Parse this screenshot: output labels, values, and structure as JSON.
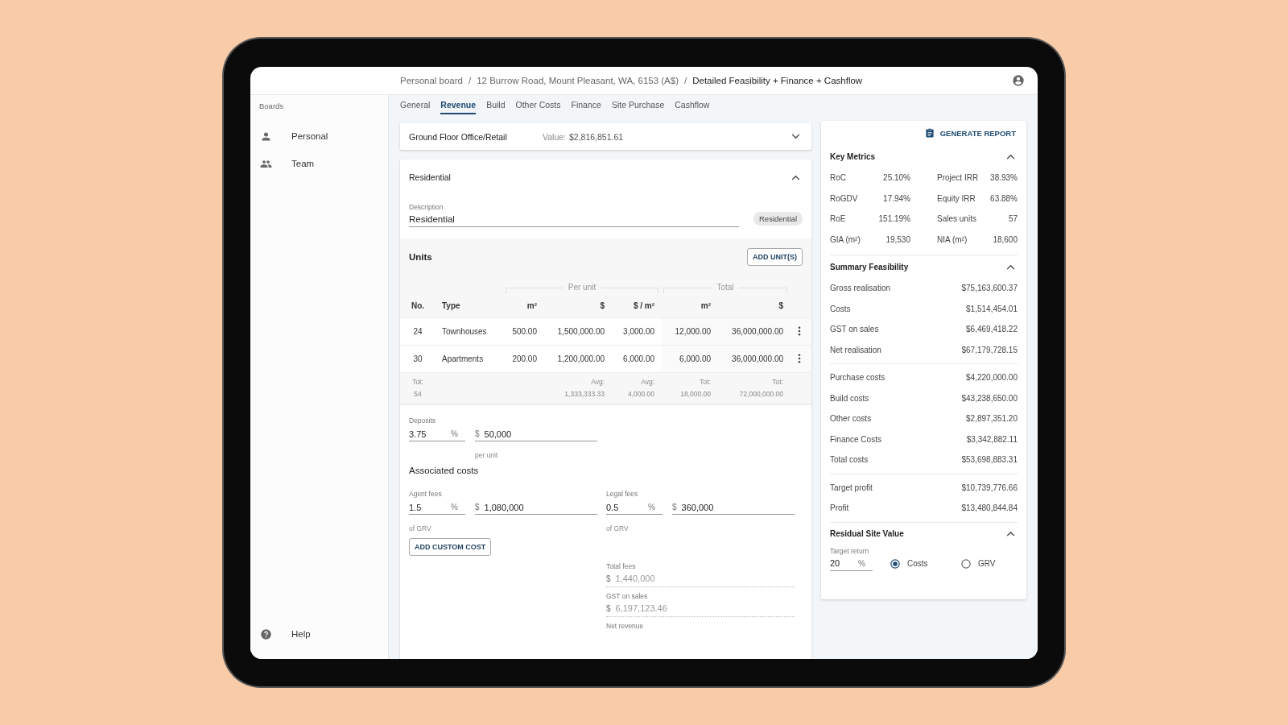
{
  "breadcrumb": [
    {
      "label": "Personal board",
      "current": false
    },
    {
      "label": "12 Burrow Road, Mount Pleasant, WA, 6153 (A$)",
      "current": false
    },
    {
      "label": "Detailed Feasibility + Finance + Cashflow",
      "current": true
    }
  ],
  "breadcrumb_separator": "/",
  "sidebar": {
    "heading": "Boards",
    "items": [
      {
        "label": "Personal"
      },
      {
        "label": "Team"
      }
    ],
    "help": "Help"
  },
  "tabs": [
    {
      "label": "General",
      "selected": false
    },
    {
      "label": "Revenue",
      "selected": true
    },
    {
      "label": "Build",
      "selected": false
    },
    {
      "label": "Other Costs",
      "selected": false
    },
    {
      "label": "Finance",
      "selected": false
    },
    {
      "label": "Site Purchase",
      "selected": false
    },
    {
      "label": "Cashflow",
      "selected": false
    }
  ],
  "collapsed_section": {
    "title": "Ground Floor Office/Retail",
    "value_label": "Value:",
    "value": "$2,816,851.61",
    "expanded": false
  },
  "residential": {
    "title": "Residential",
    "expanded": true,
    "description": {
      "label": "Description",
      "value": "Residential"
    },
    "chip": "Residential",
    "units": {
      "title": "Units",
      "add_button": "ADD UNIT(S)",
      "group_headers": [
        "Per unit",
        "Total"
      ],
      "columns": [
        "No.",
        "Type",
        "m²",
        "$",
        "$ / m²",
        "m²",
        "$"
      ],
      "rows": [
        {
          "cells": [
            "24",
            "Townhouses",
            "500.00",
            "1,500,000.00",
            "3,000.00",
            "12,000.00",
            "36,000,000.00"
          ]
        },
        {
          "cells": [
            "30",
            "Apartments",
            "200.00",
            "1,200,000.00",
            "6,000.00",
            "6,000.00",
            "36,000,000.00"
          ]
        }
      ],
      "totals": [
        {
          "label": "Tot:",
          "value": "54"
        },
        {
          "label": "Avg:",
          "value": "1,333,333.33"
        },
        {
          "label": "Avg:",
          "value": "4,000.00"
        },
        {
          "label": "Tot:",
          "value": "18,000.00"
        },
        {
          "label": "Tot:",
          "value": "72,000,000.00"
        }
      ]
    },
    "deposits": {
      "label": "Deposits",
      "percent": "3.75",
      "percent_unit": "%",
      "currency": "$",
      "amount": "50,000",
      "hint": "per unit"
    },
    "associated_costs": {
      "title": "Associated costs",
      "fees": [
        {
          "label": "Agent fees",
          "percent": "1.5",
          "percent_unit": "%",
          "currency": "$",
          "amount": "1,080,000",
          "hint": "of GRV"
        },
        {
          "label": "Legal fees",
          "percent": "0.5",
          "percent_unit": "%",
          "currency": "$",
          "amount": "360,000",
          "hint": "of GRV"
        }
      ],
      "add_button": "ADD CUSTOM COST",
      "readonly_fields": [
        {
          "label": "Total fees",
          "currency": "$",
          "value": "1,440,000"
        },
        {
          "label": "GST on sales",
          "currency": "$",
          "value": "6,197,123.46"
        },
        {
          "label": "Net revenue"
        }
      ]
    }
  },
  "summary_panel": {
    "generate_button": "GENERATE REPORT",
    "key_metrics": {
      "title": "Key Metrics",
      "expanded": true,
      "items": [
        {
          "label": "RoC",
          "value": "25.10%"
        },
        {
          "label": "Project IRR",
          "value": "38.93%"
        },
        {
          "label": "RoGDV",
          "value": "17.94%"
        },
        {
          "label": "Equity IRR",
          "value": "63.88%"
        },
        {
          "label": "RoE",
          "value": "151.19%"
        },
        {
          "label": "Sales units",
          "value": "57"
        },
        {
          "label": "GIA (m²)",
          "value": "19,530"
        },
        {
          "label": "NIA (m²)",
          "value": "18,600"
        }
      ]
    },
    "summary_feasibility": {
      "title": "Summary Feasibility",
      "expanded": true,
      "groups": [
        {
          "rows": [
            {
              "label": "Gross realisation",
              "value": "$75,163,600.37"
            },
            {
              "label": "Costs",
              "value": "$1,514,454.01"
            },
            {
              "label": "GST on sales",
              "value": "$6,469,418.22"
            },
            {
              "label": "Net realisation",
              "value": "$67,179,728.15"
            }
          ]
        },
        {
          "rows": [
            {
              "label": "Purchase costs",
              "value": "$4,220,000.00"
            },
            {
              "label": "Build costs",
              "value": "$43,238,650.00"
            },
            {
              "label": "Other costs",
              "value": "$2,897,351.20"
            },
            {
              "label": "Finance Costs",
              "value": "$3,342,882.11"
            },
            {
              "label": "Total costs",
              "value": "$53,698,883.31"
            }
          ]
        },
        {
          "rows": [
            {
              "label": "Target profit",
              "value": "$10,739,776.66"
            },
            {
              "label": "Profit",
              "value": "$13,480,844.84"
            }
          ]
        }
      ]
    },
    "residual_site_value": {
      "title": "Residual Site Value",
      "expanded": true,
      "target_return": {
        "label": "Target return",
        "value": "20",
        "unit": "%"
      },
      "options": [
        {
          "label": "Costs",
          "selected": true
        },
        {
          "label": "GRV",
          "selected": false
        }
      ]
    }
  }
}
